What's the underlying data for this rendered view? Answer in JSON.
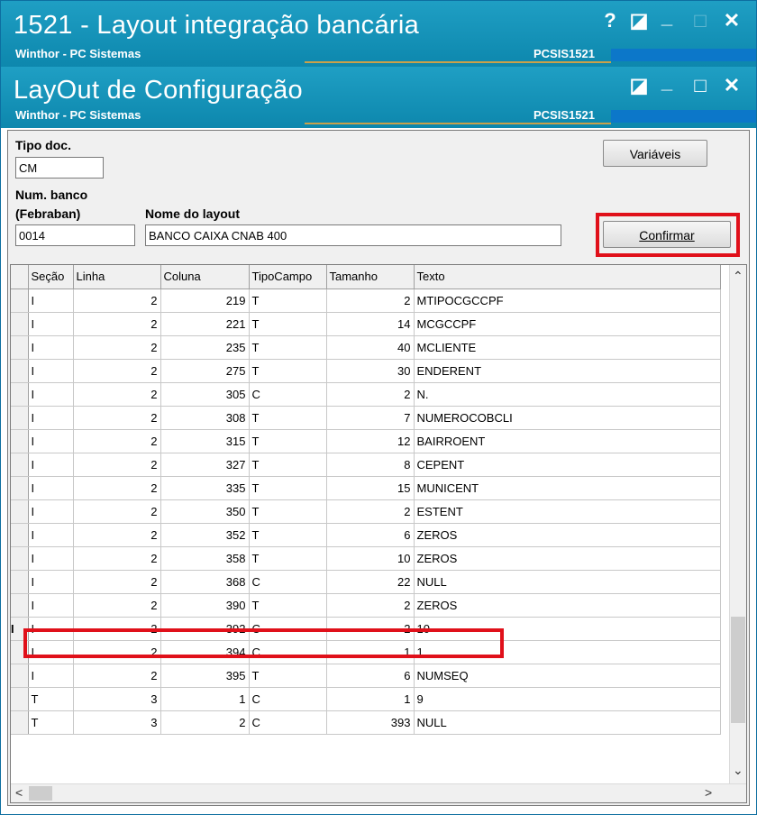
{
  "outer_window": {
    "title": "1521 - Layout integração bancária",
    "subtitle": "Winthor - PC Sistemas",
    "code": "PCSIS1521",
    "controls": {
      "help": "?",
      "restore": "◪",
      "minimize": "_",
      "maximize": "□",
      "close": "✕"
    }
  },
  "inner_window": {
    "title": "LayOut de Configuração",
    "subtitle": "Winthor - PC Sistemas",
    "code": "PCSIS1521",
    "controls": {
      "restore": "◪",
      "minimize": "_",
      "maximize": "□",
      "close": "✕"
    }
  },
  "form": {
    "tipo_doc_label": "Tipo doc.",
    "tipo_doc_value": "CM",
    "num_banco_label_1": "Num. banco",
    "num_banco_label_2": "(Febraban)",
    "num_banco_value": "0014",
    "nome_layout_label": "Nome do layout",
    "nome_layout_value": "BANCO CAIXA CNAB 400",
    "variaveis_button": "Variáveis",
    "confirmar_button": "Confirmar"
  },
  "grid": {
    "columns": [
      "Seção",
      "Linha",
      "Coluna",
      "TipoCampo",
      "Tamanho",
      "Texto"
    ],
    "rows": [
      {
        "secao": "I",
        "linha": "2",
        "coluna": "219",
        "tipo": "T",
        "tamanho": "2",
        "texto": "MTIPOCGCCPF"
      },
      {
        "secao": "I",
        "linha": "2",
        "coluna": "221",
        "tipo": "T",
        "tamanho": "14",
        "texto": "MCGCCPF"
      },
      {
        "secao": "I",
        "linha": "2",
        "coluna": "235",
        "tipo": "T",
        "tamanho": "40",
        "texto": "MCLIENTE"
      },
      {
        "secao": "I",
        "linha": "2",
        "coluna": "275",
        "tipo": "T",
        "tamanho": "30",
        "texto": "ENDERENT"
      },
      {
        "secao": "I",
        "linha": "2",
        "coluna": "305",
        "tipo": "C",
        "tamanho": "2",
        "texto": "N."
      },
      {
        "secao": "I",
        "linha": "2",
        "coluna": "308",
        "tipo": "T",
        "tamanho": "7",
        "texto": "NUMEROCOBCLI"
      },
      {
        "secao": "I",
        "linha": "2",
        "coluna": "315",
        "tipo": "T",
        "tamanho": "12",
        "texto": "BAIRROENT"
      },
      {
        "secao": "I",
        "linha": "2",
        "coluna": "327",
        "tipo": "T",
        "tamanho": "8",
        "texto": "CEPENT"
      },
      {
        "secao": "I",
        "linha": "2",
        "coluna": "335",
        "tipo": "T",
        "tamanho": "15",
        "texto": "MUNICENT"
      },
      {
        "secao": "I",
        "linha": "2",
        "coluna": "350",
        "tipo": "T",
        "tamanho": "2",
        "texto": "ESTENT"
      },
      {
        "secao": "I",
        "linha": "2",
        "coluna": "352",
        "tipo": "T",
        "tamanho": "6",
        "texto": "ZEROS"
      },
      {
        "secao": "I",
        "linha": "2",
        "coluna": "358",
        "tipo": "T",
        "tamanho": "10",
        "texto": "ZEROS"
      },
      {
        "secao": "I",
        "linha": "2",
        "coluna": "368",
        "tipo": "C",
        "tamanho": "22",
        "texto": "NULL"
      },
      {
        "secao": "I",
        "linha": "2",
        "coluna": "390",
        "tipo": "T",
        "tamanho": "2",
        "texto": "ZEROS"
      },
      {
        "secao": "I",
        "linha": "2",
        "coluna": "392",
        "tipo": "C",
        "tamanho": "2",
        "texto": "10"
      },
      {
        "secao": "I",
        "linha": "2",
        "coluna": "394",
        "tipo": "C",
        "tamanho": "1",
        "texto": "1"
      },
      {
        "secao": "I",
        "linha": "2",
        "coluna": "395",
        "tipo": "T",
        "tamanho": "6",
        "texto": "NUMSEQ"
      },
      {
        "secao": "T",
        "linha": "3",
        "coluna": "1",
        "tipo": "C",
        "tamanho": "1",
        "texto": "9"
      },
      {
        "secao": "T",
        "linha": "3",
        "coluna": "2",
        "tipo": "C",
        "tamanho": "393",
        "texto": "NULL"
      }
    ],
    "current_row_indicator": "I"
  },
  "colors": {
    "titlebar": "#1595bd",
    "highlight": "#e0101a",
    "scroll_thumb": "#cdcdcd"
  }
}
